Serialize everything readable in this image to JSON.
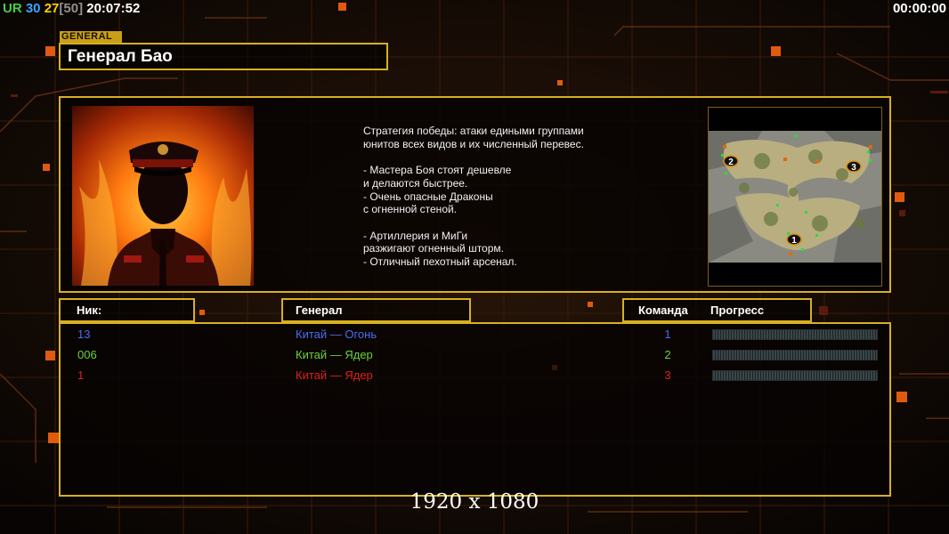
{
  "topbar": {
    "ur_label": "UR",
    "ur_value": "30",
    "fps": "27",
    "fps_limit": "[50]",
    "clock": "20:07:52",
    "game_timer": "00:00:00"
  },
  "general": {
    "tag": "GENERAL",
    "name": "Генерал Бао"
  },
  "strategy_lines": [
    "Стратегия победы: атаки едиными группами",
    "юнитов всех видов и их численный перевес.",
    "",
    "- Мастера Боя стоят дешевле",
    "и делаются быстрее.",
    "- Очень опасные Драконы",
    "с огненной стеной.",
    "",
    "- Артиллерия и МиГи",
    "разжигают огненный шторм.",
    "- Отличный пехотный арсенал."
  ],
  "minimap": {
    "start_positions": [
      "1",
      "2",
      "3"
    ]
  },
  "headers": {
    "nick": "Ник:",
    "general": "Генерал",
    "team": "Команда",
    "progress": "Прогресс"
  },
  "players": [
    {
      "nick": "13",
      "general": "Китай — Огонь",
      "team": "1",
      "color": "#4a6cf0",
      "progress": 0
    },
    {
      "nick": "006",
      "general": "Китай — Ядер",
      "team": "2",
      "color": "#6ad23a",
      "progress": 0
    },
    {
      "nick": "1",
      "general": "Китай — Ядер",
      "team": "3",
      "color": "#e02020",
      "progress": 0
    }
  ],
  "resolution": "1920 x 1080",
  "colors": {
    "frame": "#d8b020",
    "ur_label": "#40d040",
    "ur_value": "#40a0ff",
    "fps": "#ffd000",
    "fps_limit": "#909090"
  }
}
